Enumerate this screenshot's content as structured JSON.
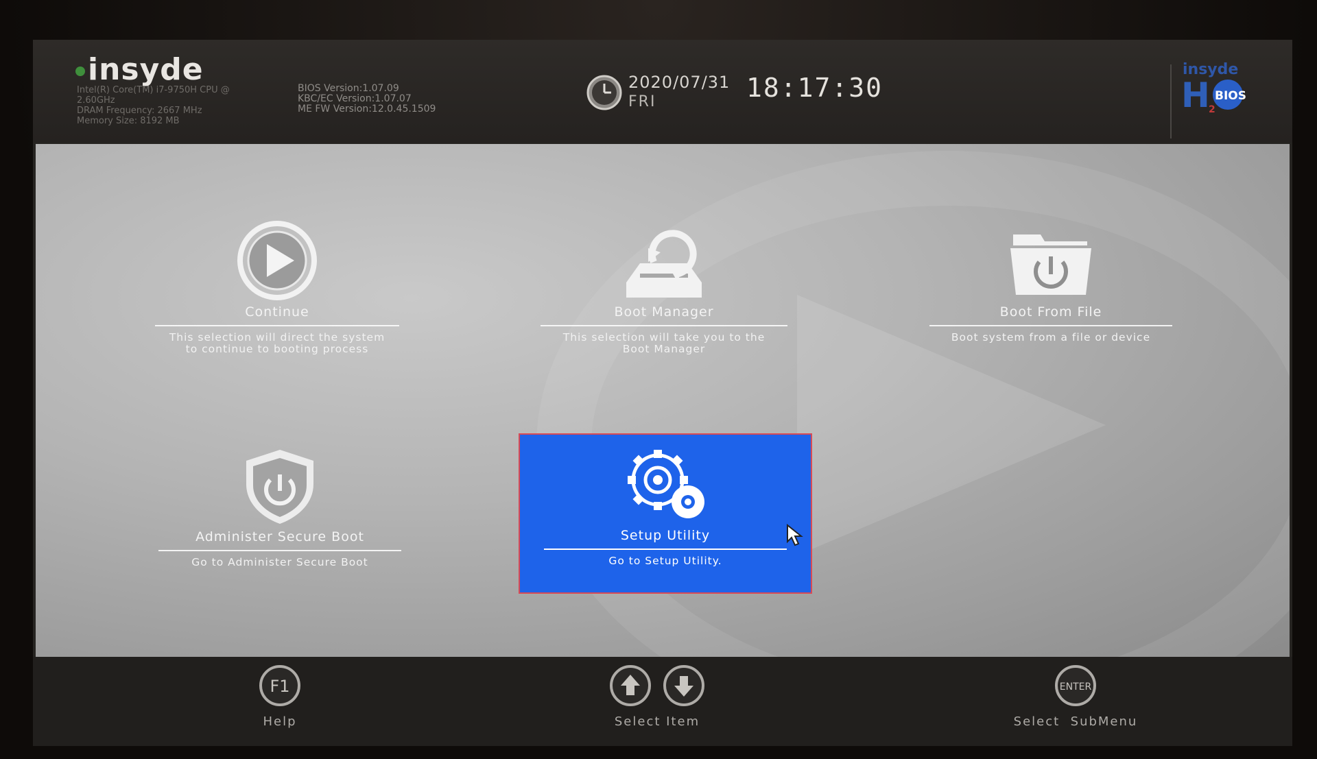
{
  "header": {
    "brand": "insyde",
    "cpu_line1": "Intel(R) Core(TM) i7-9750H CPU @",
    "cpu_line2": "2.60GHz",
    "dram": "DRAM Frequency: 2667 MHz",
    "memory": "Memory Size: 8192 MB",
    "bios_version": "BIOS Version:1.07.09",
    "kbc_version": "KBC/EC Version:1.07.07",
    "me_version": "ME FW Version:12.0.45.1509",
    "date": "2020/07/31",
    "day": "FRI",
    "time": "18:17:30",
    "h2o_top": "insyde",
    "h2o_main": "H",
    "h2o_badge": "BIOS",
    "h2o_sub": "2"
  },
  "menu": [
    {
      "title": "Continue",
      "desc1": "This selection will direct the system",
      "desc2": "to continue to booting process"
    },
    {
      "title": "Boot Manager",
      "desc1": "This selection will take you to the",
      "desc2": "Boot Manager"
    },
    {
      "title": "Boot From File",
      "desc1": "Boot system from a file or device",
      "desc2": ""
    },
    {
      "title": "Administer Secure Boot",
      "desc1": "Go to Administer Secure Boot",
      "desc2": ""
    },
    {
      "title": "Setup Utility",
      "desc1": "Go to Setup Utility.",
      "desc2": ""
    }
  ],
  "colors": {
    "selected": "#1e63ea",
    "selected_border": "#d84a55"
  },
  "footer": {
    "help_key": "F1",
    "help_label": "Help",
    "select_item_label": "Select Item",
    "enter_key": "ENTER",
    "submenu_label": "Select  SubMenu"
  }
}
